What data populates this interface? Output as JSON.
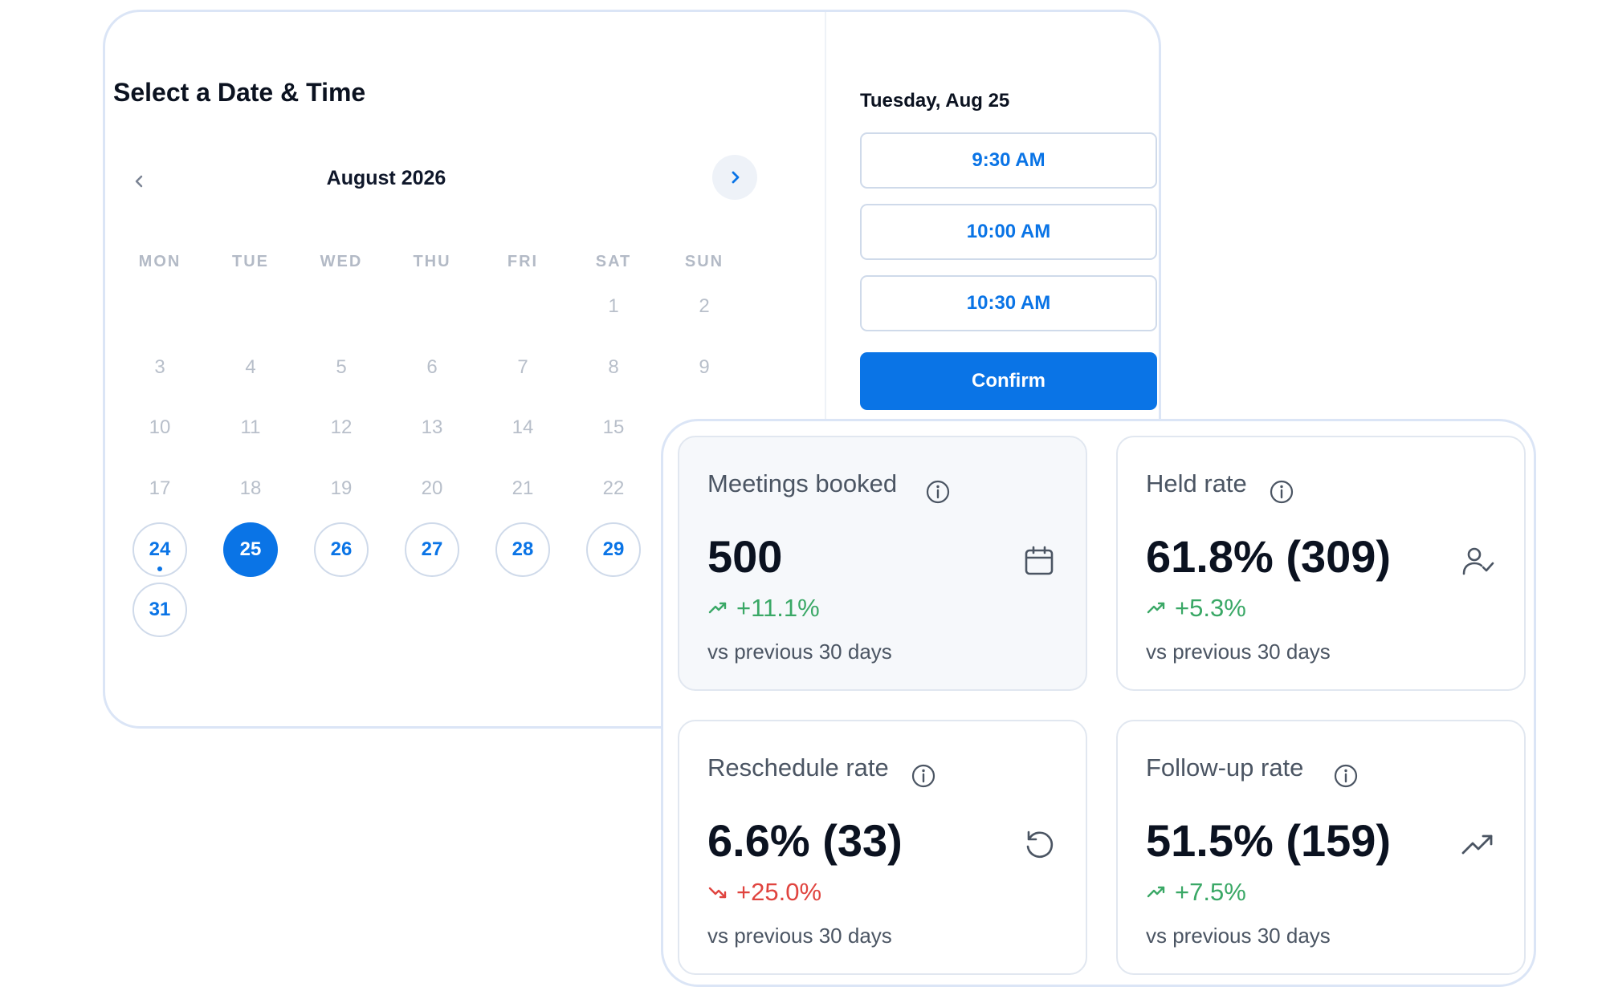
{
  "scheduler": {
    "title": "Select a Date & Time",
    "month_label": "August 2026",
    "weekdays": [
      "MON",
      "TUE",
      "WED",
      "THU",
      "FRI",
      "SAT",
      "SUN"
    ],
    "days": {
      "d1": "1",
      "d2": "2",
      "d3": "3",
      "d4": "4",
      "d5": "5",
      "d6": "6",
      "d7": "7",
      "d8": "8",
      "d9": "9",
      "d10": "10",
      "d11": "11",
      "d12": "12",
      "d13": "13",
      "d14": "14",
      "d15": "15",
      "d17": "17",
      "d18": "18",
      "d19": "19",
      "d20": "20",
      "d21": "21",
      "d22": "22",
      "d24": "24",
      "d25": "25",
      "d26": "26",
      "d27": "27",
      "d28": "28",
      "d29": "29",
      "d31": "31"
    },
    "selected_day": "25",
    "today_day": "24",
    "selected_date_heading": "Tuesday, Aug 25",
    "time_slots": [
      "9:30 AM",
      "10:00 AM",
      "10:30 AM"
    ],
    "confirm_label": "Confirm",
    "accent_color": "#0a74e6"
  },
  "stats": {
    "comparison_label": "vs previous 30 days",
    "cards": [
      {
        "title": "Meetings booked",
        "value": "500",
        "trend": "+11.1%",
        "trend_direction": "up",
        "icon": "calendar-icon"
      },
      {
        "title": "Held rate",
        "value": "61.8% (309)",
        "trend": "+5.3%",
        "trend_direction": "up",
        "icon": "user-check-icon"
      },
      {
        "title": "Reschedule rate",
        "value": "6.6% (33)",
        "trend": "+25.0%",
        "trend_direction": "down",
        "icon": "refresh-icon"
      },
      {
        "title": "Follow-up rate",
        "value": "51.5% (159)",
        "trend": "+7.5%",
        "trend_direction": "up",
        "icon": "trending-up-icon"
      }
    ],
    "colors": {
      "positive": "#3aa866",
      "negative": "#e0443f"
    }
  }
}
